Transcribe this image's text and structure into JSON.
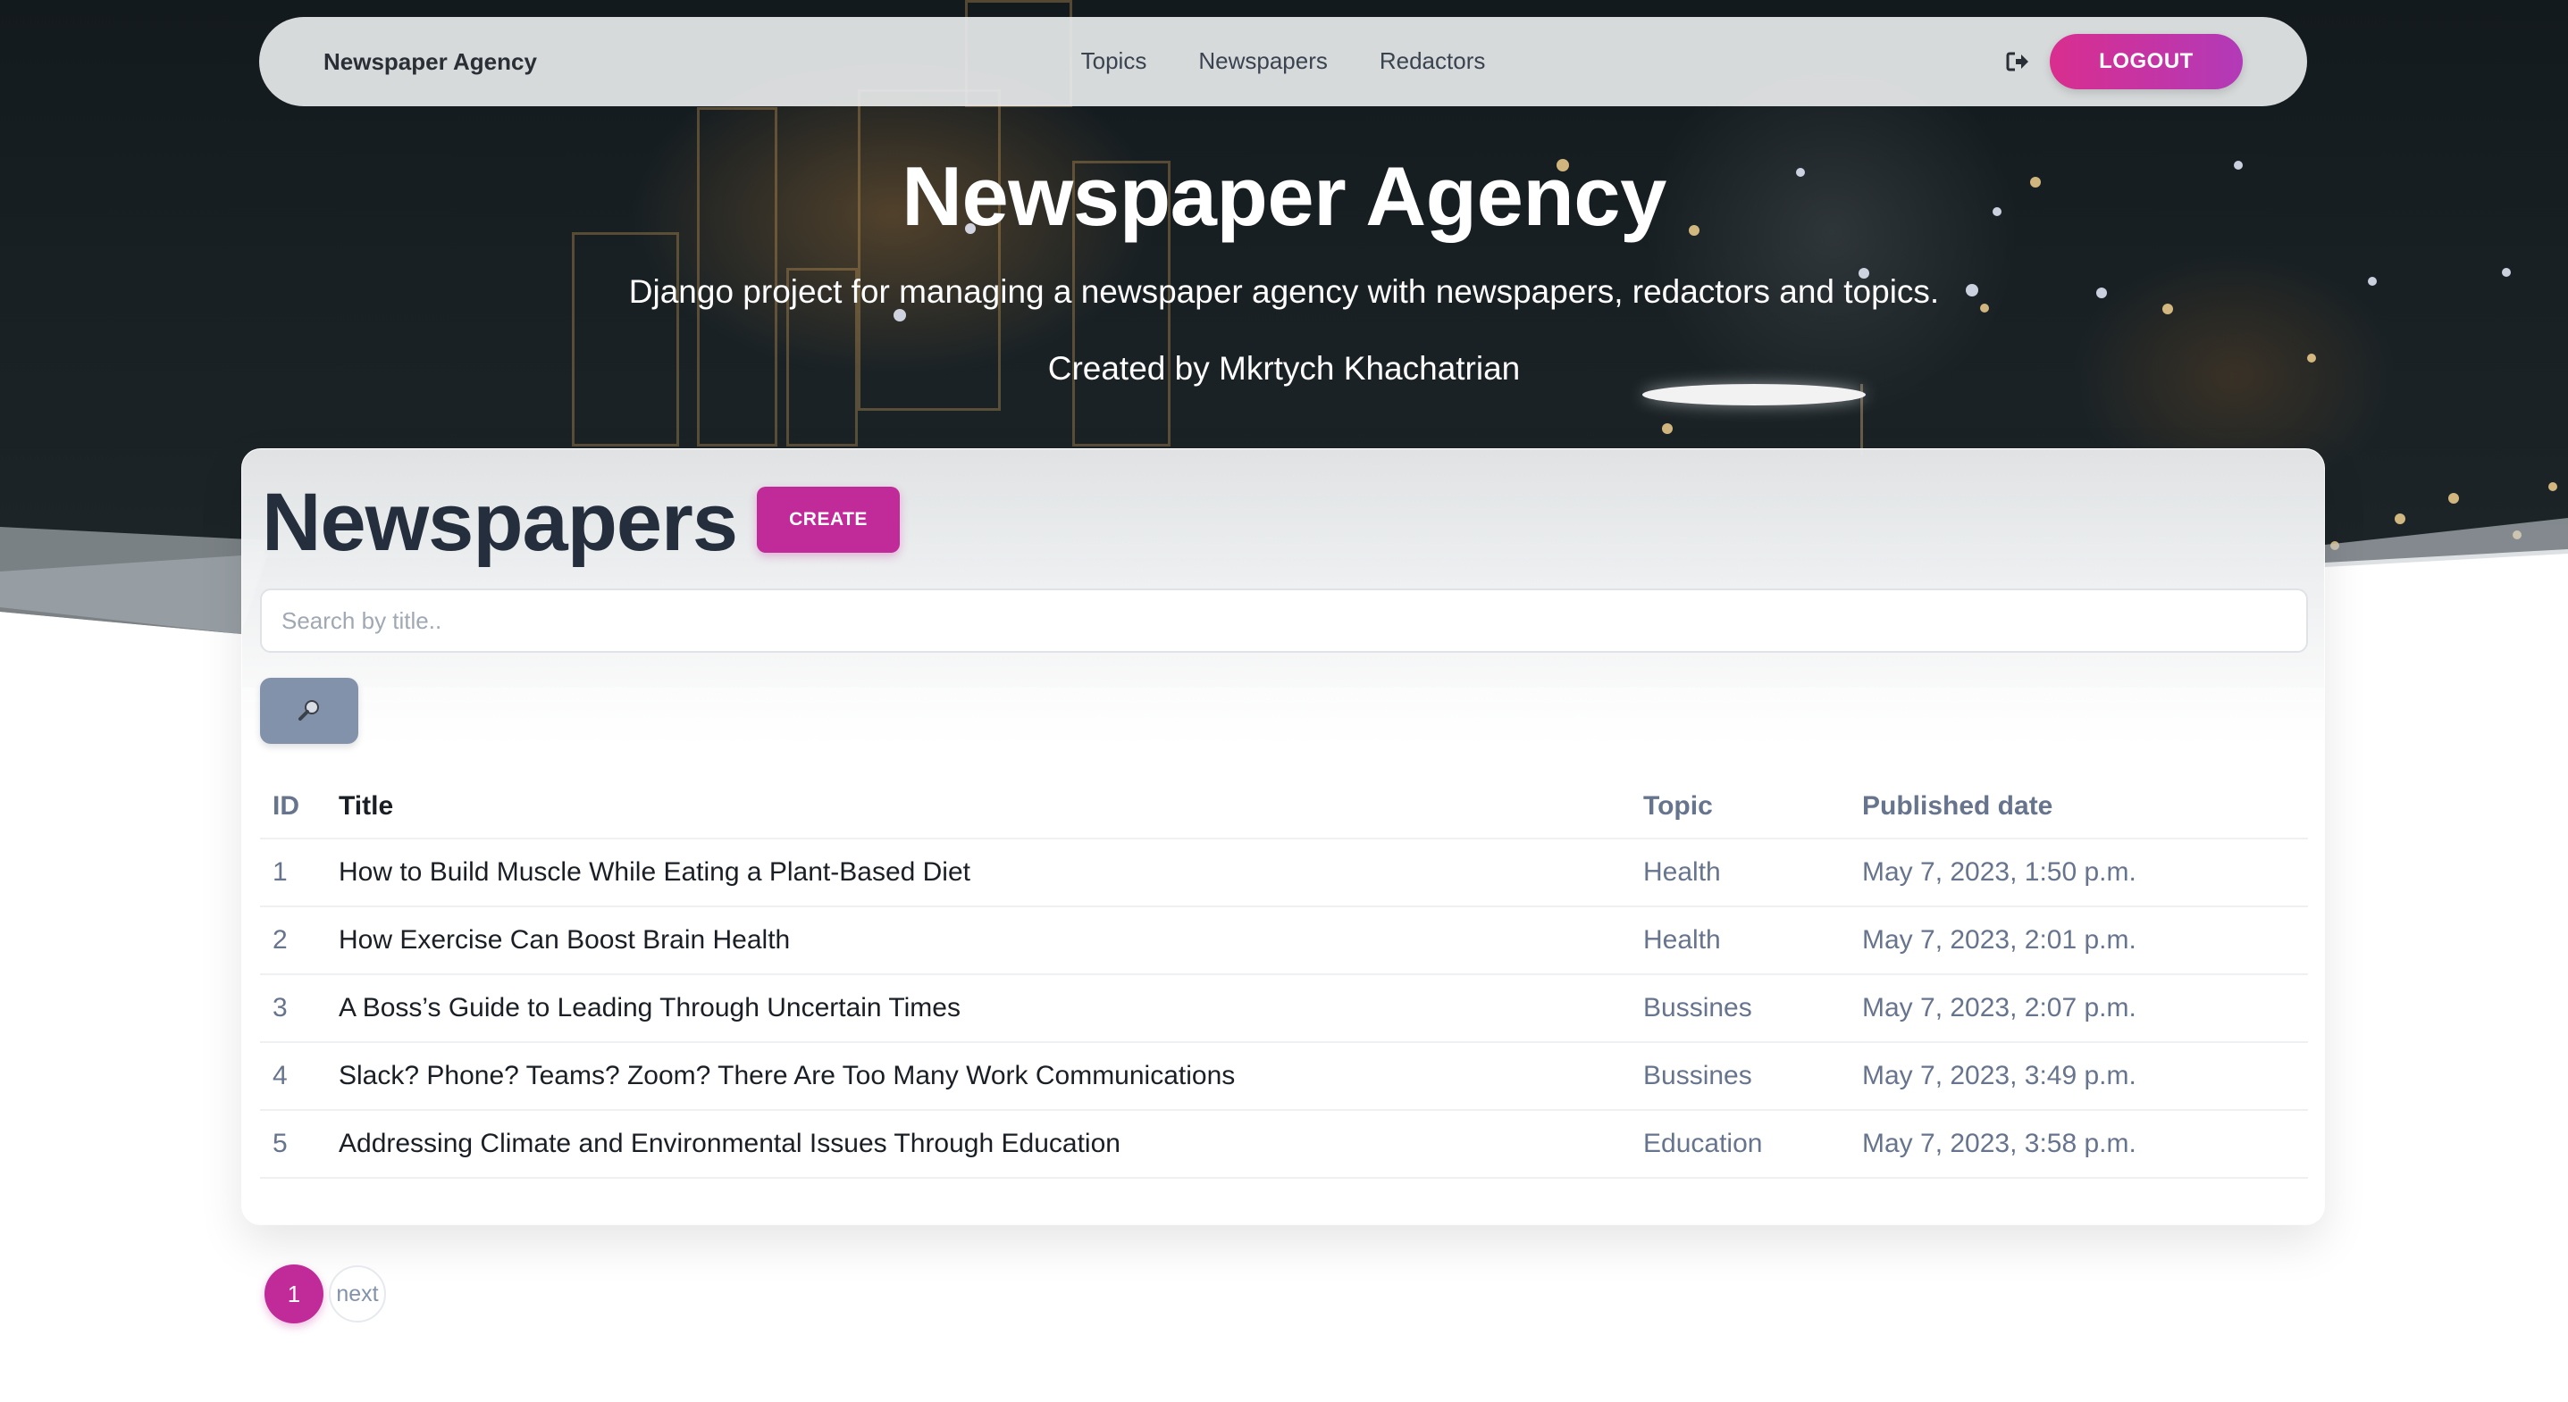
{
  "navbar": {
    "brand": "Newspaper Agency",
    "links": [
      "Topics",
      "Newspapers",
      "Redactors"
    ],
    "logout_label": "LOGOUT",
    "logout_icon": "sign-out-icon"
  },
  "hero": {
    "title": "Newspaper Agency",
    "subtitle": "Django project for managing a newspaper agency with newspapers, redactors and topics.",
    "author": "Created by Mkrtych Khachatrian"
  },
  "main": {
    "title": "Newspapers",
    "create_label": "CREATE",
    "search_placeholder": "Search by title..",
    "search_icon": "magnifier-icon",
    "table": {
      "headers": [
        "ID",
        "Title",
        "Topic",
        "Published date"
      ],
      "rows": [
        {
          "id": "1",
          "title": "How to Build Muscle While Eating a Plant-Based Diet",
          "topic": "Health",
          "date": "May 7, 2023, 1:50 p.m."
        },
        {
          "id": "2",
          "title": "How Exercise Can Boost Brain Health",
          "topic": "Health",
          "date": "May 7, 2023, 2:01 p.m."
        },
        {
          "id": "3",
          "title": "A Boss’s Guide to Leading Through Uncertain Times",
          "topic": "Bussines",
          "date": "May 7, 2023, 2:07 p.m."
        },
        {
          "id": "4",
          "title": "Slack? Phone? Teams? Zoom? There Are Too Many Work Communications",
          "topic": "Bussines",
          "date": "May 7, 2023, 3:49 p.m."
        },
        {
          "id": "5",
          "title": "Addressing Climate and Environmental Issues Through Education",
          "topic": "Education",
          "date": "May 7, 2023, 3:58 p.m."
        }
      ]
    }
  },
  "pagination": {
    "current": "1",
    "next_label": "next"
  },
  "colors": {
    "accent": "#c02a99",
    "logout_gradient_start": "#d92e8f",
    "logout_gradient_end": "#b23ab8",
    "search_button": "#8392ab",
    "heading": "#252e3d",
    "muted_text": "#67748e"
  }
}
